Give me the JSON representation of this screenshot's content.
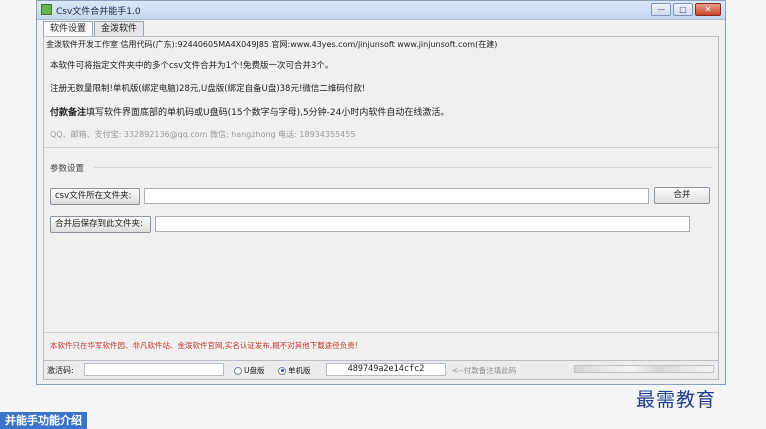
{
  "window": {
    "title": "Csv文件合并能手1.0",
    "controls": [
      "minimize",
      "maximize",
      "close"
    ]
  },
  "tabs": [
    {
      "label": "软件设置",
      "active": true
    },
    {
      "label": "金泼软件",
      "active": false
    }
  ],
  "info": {
    "company_line": "金泼软件开发工作室 信用代码(广东):92440605MA4X049J85 官网:www.43yes.com/jinjunsoft www.jinjunsoft.com(在建)",
    "line1": "本软件可将指定文件夹中的多个csv文件合并为1个!免费版一次可合并3个。",
    "line2": "注册无数量限制!单机版(绑定电脑)28元,U盘版(绑定自备U盘)38元!微信二维码付款!",
    "line3_bold": "付款备注",
    "line3_rest": "填写软件界面底部的单机码或U盘码(15个数字与字母),5分钟-24小时内软件自动在线激活。",
    "contact_line": "QQ、邮箱、支付宝: 332892136@qq.com  微信: hangzhong  电话: 18934355455"
  },
  "params": {
    "group_title": "参数设置",
    "source_folder_label": "csv文件所在文件夹:",
    "source_folder_value": "",
    "merge_button": "合并",
    "target_folder_label": "合并后保存到此文件夹:",
    "target_folder_value": ""
  },
  "warning": "本软件只在华军软件园、非凡软件站、金泼软件官网,实名认证发布,概不对其他下载途径负责!",
  "status": {
    "activation_label": "激活码:",
    "activation_value": "",
    "radio_usb": "U盘版",
    "radio_single": "单机版",
    "selected": "单机版",
    "machine_code": "489749a2e14cfc2",
    "hint": "<--付款备注填此码"
  },
  "caption": "并能手功能介绍",
  "watermark": "最需教育",
  "colors": {
    "warning": "#c0392b",
    "caption_bg": "#3a73c8",
    "watermark": "#1f3f8a"
  }
}
